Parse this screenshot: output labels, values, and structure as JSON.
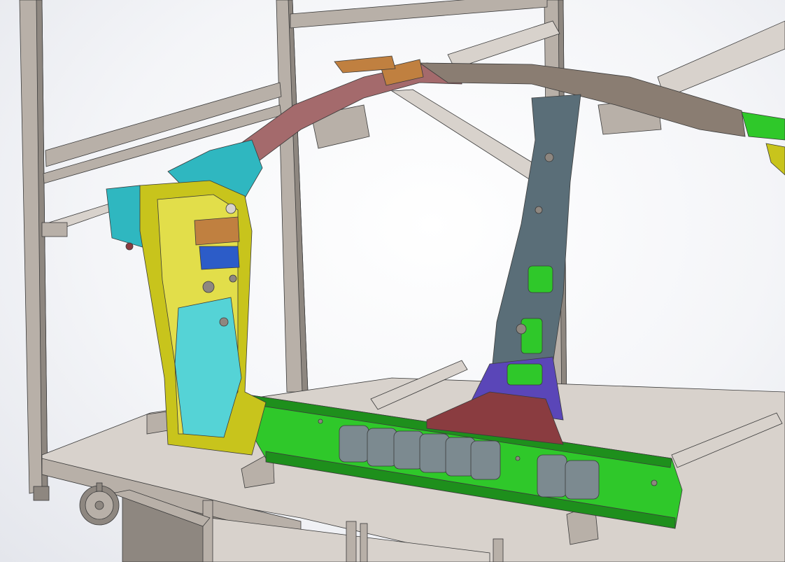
{
  "scene": {
    "background": "#f2f3f6",
    "colors": {
      "frame_steel": "#b8b0a8",
      "frame_steel_dark": "#8e8780",
      "frame_steel_light": "#d8d2cc",
      "rocker_green": "#2fc82a",
      "rocker_green_dark": "#1e8f1c",
      "a_pillar_yellow": "#c8c41c",
      "a_pillar_yellow_light": "#e2de4a",
      "hinge_teal": "#2fb7c0",
      "hinge_teal_light": "#55d3d6",
      "roof_rail_mauve": "#a46a6c",
      "roof_rail_taupe": "#8a7d72",
      "b_pillar_slate": "#5a6e78",
      "b_pillar_purple": "#5a46b8",
      "b_pillar_maroon": "#8a3c40",
      "bracket_orange": "#c08040",
      "bracket_blue": "#2c5cc8",
      "bracket_grey": "#7c8a90"
    },
    "icons": {
      "caster_wheel": "caster-wheel-icon"
    }
  }
}
